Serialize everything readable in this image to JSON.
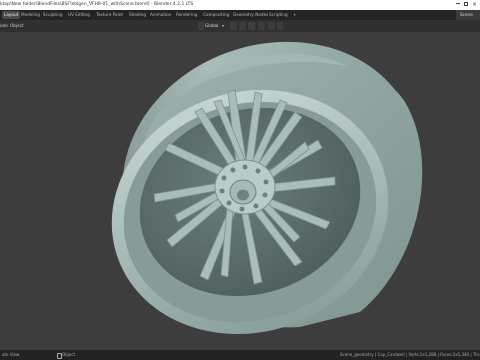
{
  "window": {
    "title": "ktop\\New folder\\BlendFiles\\BSF\\Volgen_VFH8-01_withScene.blend] - Blender 4.2.1 LTS"
  },
  "tabs": [
    "Layout",
    "Modeling",
    "Sculpting",
    "UV Editing",
    "Texture Paint",
    "Shading",
    "Animation",
    "Rendering",
    "Compositing",
    "Geometry Nodes",
    "Scripting",
    "+"
  ],
  "active_tab": "Layout",
  "scene_name": "Scene",
  "header": {
    "mode_label": "ode",
    "menu_object": "Object",
    "transform_orientation": "Global"
  },
  "status": {
    "left": "ate View",
    "middle": "Object",
    "right": "Scene_geometry | Cap_Cardwell | Verts:2x1,288 | Faces:2x1,340 | Tris:440"
  },
  "colors": {
    "viewport_bg": "#3d3d3d",
    "wheel_base": "#9ab0ab",
    "wheel_light": "#bdcfcb",
    "wheel_dark": "#6f8581",
    "active_tab_bg": "#4a4a4a"
  }
}
